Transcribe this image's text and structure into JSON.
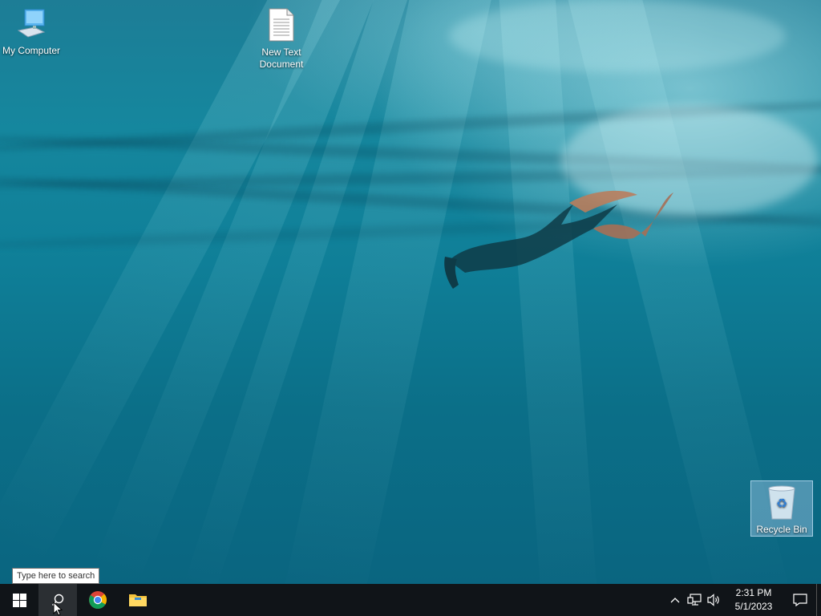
{
  "desktop": {
    "icons": [
      {
        "name": "my-computer",
        "label": "My Computer"
      },
      {
        "name": "new-text-document",
        "label": "New Text\nDocument"
      },
      {
        "name": "recycle-bin",
        "label": "Recycle Bin"
      }
    ]
  },
  "search_tooltip": "Type here to search",
  "taskbar": {
    "pinned": [
      "start-button",
      "search-button",
      "chrome-button",
      "file-explorer-button"
    ]
  },
  "tray": {
    "time": "2:31 PM",
    "date": "5/1/2023"
  }
}
